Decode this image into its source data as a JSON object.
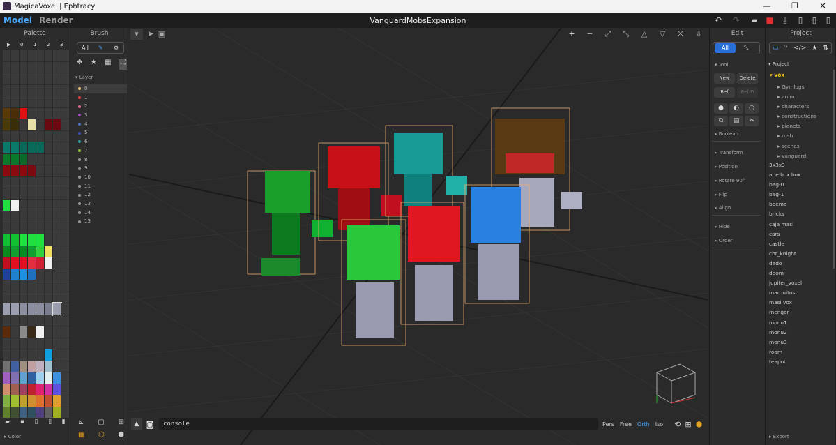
{
  "window": {
    "title": "MagicaVoxel | Ephtracy",
    "min": "—",
    "max": "❐",
    "close": "✕"
  },
  "menu": {
    "model": "Model",
    "render": "Render",
    "project_name": "VanguardMobsExpansion"
  },
  "palette": {
    "title": "Palette",
    "cols": [
      "▶",
      "0",
      "1",
      "2",
      "3"
    ],
    "footer": "Color",
    "colors": [
      [
        "#3a3a3a",
        "#3a3a3a",
        "#3a3a3a",
        "#3a3a3a",
        "#3a3a3a",
        "#3a3a3a",
        "#3a3a3a",
        "#3a3a3a"
      ],
      [
        "#3a3a3a",
        "#3a3a3a",
        "#3a3a3a",
        "#3a3a3a",
        "#3a3a3a",
        "#3a3a3a",
        "#3a3a3a",
        "#3a3a3a"
      ],
      [
        "#3a3a3a",
        "#3a3a3a",
        "#3a3a3a",
        "#3a3a3a",
        "#3a3a3a",
        "#3a3a3a",
        "#3a3a3a",
        "#3a3a3a"
      ],
      [
        "#3a3a3a",
        "#3a3a3a",
        "#3a3a3a",
        "#3a3a3a",
        "#3a3a3a",
        "#3a3a3a",
        "#3a3a3a",
        "#3a3a3a"
      ],
      [
        "#3a3a3a",
        "#3a3a3a",
        "#3a3a3a",
        "#3a3a3a",
        "#3a3a3a",
        "#3a3a3a",
        "#3a3a3a",
        "#3a3a3a"
      ],
      [
        "#5a3a0a",
        "#4a2e08",
        "#e01010",
        "#3a3a3a",
        "#3a3a3a",
        "#3a3a3a",
        "#3a3a3a",
        "#3a3a3a"
      ],
      [
        "#4a3a0a",
        "#3a2e08",
        "#3a3a3a",
        "#e6e0a8",
        "#3a3a3a",
        "#6a0a10",
        "#6a0a10",
        "#3a3a3a"
      ],
      [
        "#3a3a3a",
        "#3a3a3a",
        "#3a3a3a",
        "#3a3a3a",
        "#3a3a3a",
        "#3a3a3a",
        "#3a3a3a",
        "#3a3a3a"
      ],
      [
        "#0a7a6a",
        "#0a7a6a",
        "#0a6a5a",
        "#0a6a5a",
        "#0a6a5a",
        "#3a3a3a",
        "#3a3a3a",
        "#3a3a3a"
      ],
      [
        "#0a7a2a",
        "#0a7a2a",
        "#0a6a2a",
        "#3a3a3a",
        "#3a3a3a",
        "#3a3a3a",
        "#3a3a3a",
        "#3a3a3a"
      ],
      [
        "#8a0a10",
        "#8a0a10",
        "#8a0a10",
        "#7a0a10",
        "#3a3a3a",
        "#3a3a3a",
        "#3a3a3a",
        "#3a3a3a"
      ],
      [
        "#3a3a3a",
        "#3a3a3a",
        "#3a3a3a",
        "#3a3a3a",
        "#3a3a3a",
        "#3a3a3a",
        "#3a3a3a",
        "#3a3a3a"
      ],
      [
        "#3a3a3a",
        "#3a3a3a",
        "#3a3a3a",
        "#3a3a3a",
        "#3a3a3a",
        "#3a3a3a",
        "#3a3a3a",
        "#3a3a3a"
      ],
      [
        "#20e040",
        "#f0f0f0",
        "#3a3a3a",
        "#3a3a3a",
        "#3a3a3a",
        "#3a3a3a",
        "#3a3a3a",
        "#3a3a3a"
      ],
      [
        "#3a3a3a",
        "#3a3a3a",
        "#3a3a3a",
        "#3a3a3a",
        "#3a3a3a",
        "#3a3a3a",
        "#3a3a3a",
        "#3a3a3a"
      ],
      [
        "#3a3a3a",
        "#3a3a3a",
        "#3a3a3a",
        "#3a3a3a",
        "#3a3a3a",
        "#3a3a3a",
        "#3a3a3a",
        "#3a3a3a"
      ],
      [
        "#10c030",
        "#10c030",
        "#20e040",
        "#20e040",
        "#20e040",
        "#3a3a3a",
        "#3a3a3a",
        "#3a3a3a"
      ],
      [
        "#0a8a20",
        "#10a030",
        "#0a8a20",
        "#10a030",
        "#30d040",
        "#f0e060",
        "#3a3a3a",
        "#3a3a3a"
      ],
      [
        "#c01020",
        "#e01020",
        "#e01020",
        "#e03040",
        "#d02030",
        "#f0f0f0",
        "#3a3a3a",
        "#3a3a3a"
      ],
      [
        "#2040a0",
        "#2080d0",
        "#2090e0",
        "#2070c0",
        "#3a3a3a",
        "#3a3a3a",
        "#3a3a3a",
        "#3a3a3a"
      ],
      [
        "#3a3a3a",
        "#3a3a3a",
        "#3a3a3a",
        "#3a3a3a",
        "#3a3a3a",
        "#3a3a3a",
        "#3a3a3a",
        "#3a3a3a"
      ],
      [
        "#3a3a3a",
        "#3a3a3a",
        "#3a3a3a",
        "#3a3a3a",
        "#3a3a3a",
        "#3a3a3a",
        "#3a3a3a",
        "#3a3a3a"
      ],
      [
        "#9a9eae",
        "#9a9eae",
        "#8a8e9e",
        "#8a8e9e",
        "#8a8e9e",
        "#7a7e8e",
        "#9a9eae",
        "#3a3a3a"
      ],
      [
        "#3a3a3a",
        "#3a3a3a",
        "#3a3a3a",
        "#3a3a3a",
        "#3a3a3a",
        "#3a3a3a",
        "#3a3a3a",
        "#3a3a3a"
      ],
      [
        "#5a2a0a",
        "#3a3a3a",
        "#8a8a8a",
        "#3a2a1a",
        "#f0f0f0",
        "#3a3a3a",
        "#3a3a3a",
        "#3a3a3a"
      ],
      [
        "#3a3a3a",
        "#3a3a3a",
        "#3a3a3a",
        "#3a3a3a",
        "#3a3a3a",
        "#3a3a3a",
        "#3a3a3a",
        "#3a3a3a"
      ],
      [
        "#3a3a3a",
        "#3a3a3a",
        "#3a3a3a",
        "#3a3a3a",
        "#3a3a3a",
        "#10a0e0",
        "#3a3a3a",
        "#3a3a3a"
      ],
      [
        "#707070",
        "#4060a0",
        "#a09080",
        "#c0a0a0",
        "#c0b0c0",
        "#a0c0d0",
        "#3a3a3a",
        "#3a3a3a"
      ],
      [
        "#a060c0",
        "#8070b0",
        "#60a0d0",
        "#3060a0",
        "#a0d0f0",
        "#e0f0f0",
        "#4090e0",
        "#3a3a3a"
      ],
      [
        "#d09070",
        "#a06050",
        "#a04060",
        "#c02030",
        "#e02070",
        "#d030a0",
        "#6050e0",
        "#3a3a3a"
      ],
      [
        "#80b040",
        "#a0c030",
        "#c0a030",
        "#d09030",
        "#e07030",
        "#c05030",
        "#e0a030",
        "#3a3a3a"
      ],
      [
        "#608030",
        "#405030",
        "#406080",
        "#305060",
        "#504080",
        "#606060",
        "#a0b020",
        "#3a3a3a"
      ]
    ]
  },
  "brush": {
    "title": "Brush",
    "all": "All",
    "layer_title": "Layer",
    "layers": [
      {
        "n": "0",
        "c": "#e8c070"
      },
      {
        "n": "1",
        "c": "#e04040"
      },
      {
        "n": "2",
        "c": "#e07090"
      },
      {
        "n": "3",
        "c": "#a050c0"
      },
      {
        "n": "4",
        "c": "#5070c0"
      },
      {
        "n": "5",
        "c": "#4050b0"
      },
      {
        "n": "6",
        "c": "#30a0a0"
      },
      {
        "n": "7",
        "c": "#90c040"
      },
      {
        "n": "8",
        "c": "#999999"
      },
      {
        "n": "9",
        "c": "#999999"
      },
      {
        "n": "10",
        "c": "#999999"
      },
      {
        "n": "11",
        "c": "#999999"
      },
      {
        "n": "12",
        "c": "#999999"
      },
      {
        "n": "13",
        "c": "#999999"
      },
      {
        "n": "14",
        "c": "#999999"
      },
      {
        "n": "15",
        "c": "#999999"
      }
    ]
  },
  "viewport": {
    "console": "console",
    "modes": [
      "Pers",
      "Free",
      "Orth",
      "Iso"
    ],
    "active_mode": "Orth"
  },
  "edit": {
    "title": "Edit",
    "all": "All",
    "tool": "Tool",
    "new": "New",
    "delete": "Delete",
    "ref": "Ref",
    "refd": "Ref D",
    "sections": [
      "Boolean",
      "Transform",
      "Position",
      "Rotate 90°",
      "Flip",
      "Align",
      "Hide",
      "Order"
    ]
  },
  "project": {
    "title": "Project",
    "root": "Project",
    "folder": "vox",
    "subfolders": [
      "Gymlogs",
      "anim",
      "characters",
      "constructions",
      "planets",
      "rush",
      "scenes",
      "vanguard"
    ],
    "files": [
      "3x3x3",
      "ape box box",
      "bag-0",
      "bag-1",
      "beemo",
      "bricks",
      "caja masi",
      "cars",
      "castle",
      "chr_knight",
      "dado",
      "doom",
      "jupiter_voxel",
      "marquitos",
      "masi vox",
      "menger",
      "monu1",
      "monu2",
      "monu3",
      "room",
      "teapot"
    ],
    "export": "Export"
  }
}
